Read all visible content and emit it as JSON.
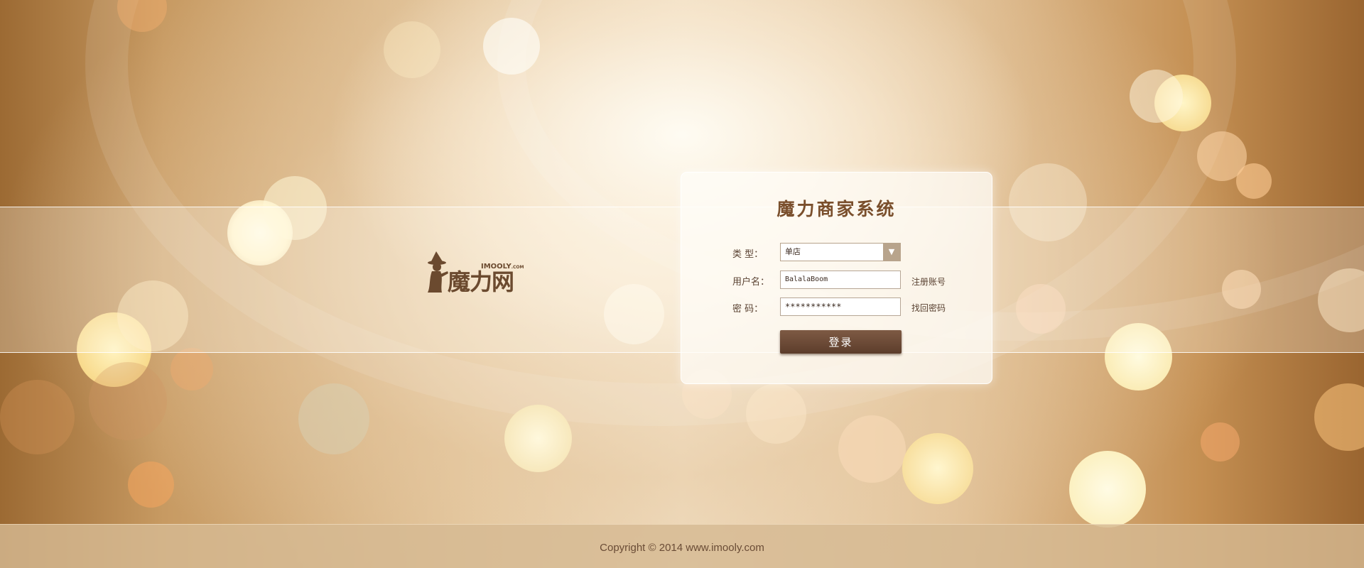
{
  "login_panel": {
    "title": "魔力商家系统",
    "type_label": "类 型：",
    "type_value": "单店",
    "username_label": "用户名：",
    "username_value": "BalalaBoom",
    "password_label": "密 码：",
    "password_value": "***********",
    "register_link": "注册账号",
    "recover_link": "找回密码",
    "login_button": "登录"
  },
  "logo": {
    "brand_text": "魔力网",
    "domain_text": "IMOOLY",
    "domain_suffix": ".COM"
  },
  "footer": {
    "copyright": "Copyright © 2014 www.imooly.com"
  },
  "colors": {
    "brand_brown": "#6b4a2f",
    "button_brown": "#5c3d2b",
    "select_arrow": "#b8a48c"
  }
}
